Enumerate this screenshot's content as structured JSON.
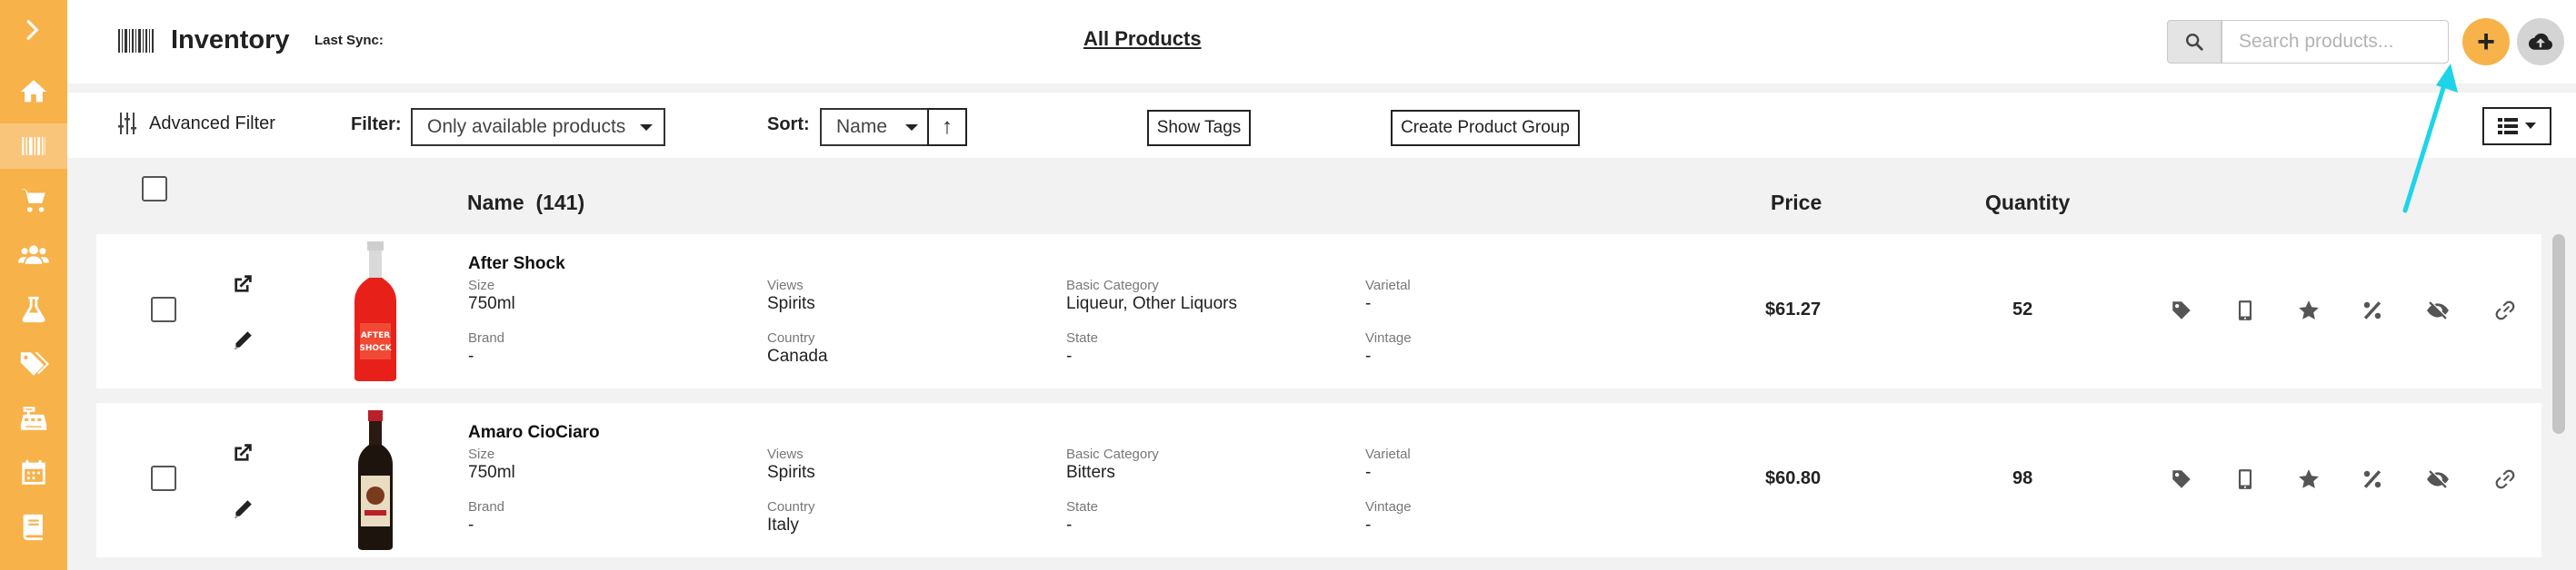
{
  "header": {
    "title": "Inventory",
    "last_sync_label": "Last Sync:",
    "all_products_link": "All Products",
    "search": {
      "placeholder": "Search products...",
      "value": ""
    },
    "add_button_label": "+"
  },
  "sidebar": {
    "toggle_icon": "chevron-right-icon",
    "items": [
      {
        "icon": "home-icon"
      },
      {
        "icon": "barcode-icon",
        "active": true
      },
      {
        "icon": "cart-icon"
      },
      {
        "icon": "users-icon"
      },
      {
        "icon": "flask-icon"
      },
      {
        "icon": "tags-icon"
      },
      {
        "icon": "cash-register-icon"
      },
      {
        "icon": "calendar-icon"
      },
      {
        "icon": "book-icon"
      }
    ]
  },
  "toolbar": {
    "advanced_filter_label": "Advanced Filter",
    "filter_label": "Filter:",
    "filter_value": "Only available products",
    "sort_label": "Sort:",
    "sort_value": "Name",
    "sort_direction": "↑",
    "show_tags_label": "Show Tags",
    "create_group_label": "Create Product Group"
  },
  "table": {
    "columns": {
      "name": "Name",
      "count": "(141)",
      "price": "Price",
      "quantity": "Quantity"
    },
    "field_labels": {
      "size": "Size",
      "brand": "Brand",
      "views": "Views",
      "country": "Country",
      "basic_category": "Basic Category",
      "state": "State",
      "varietal": "Varietal",
      "vintage": "Vintage"
    },
    "rows": [
      {
        "name": "After Shock",
        "size": "750ml",
        "brand": "-",
        "views": "Spirits",
        "country": "Canada",
        "basic_category": "Liqueur, Other Liquors",
        "state": "-",
        "varietal": "-",
        "vintage": "-",
        "price": "$61.27",
        "quantity": "52"
      },
      {
        "name": "Amaro CioCiaro",
        "size": "750ml",
        "brand": "-",
        "views": "Spirits",
        "country": "Italy",
        "basic_category": "Bitters",
        "state": "-",
        "varietal": "-",
        "vintage": "-",
        "price": "$60.80",
        "quantity": "98"
      }
    ],
    "row_actions": [
      "tag-icon",
      "mobile-icon",
      "star-icon",
      "percent-icon",
      "eye-slash-icon",
      "link-icon"
    ]
  },
  "colors": {
    "accent": "#f7b24a",
    "annotation_arrow": "#1ed4e8"
  }
}
